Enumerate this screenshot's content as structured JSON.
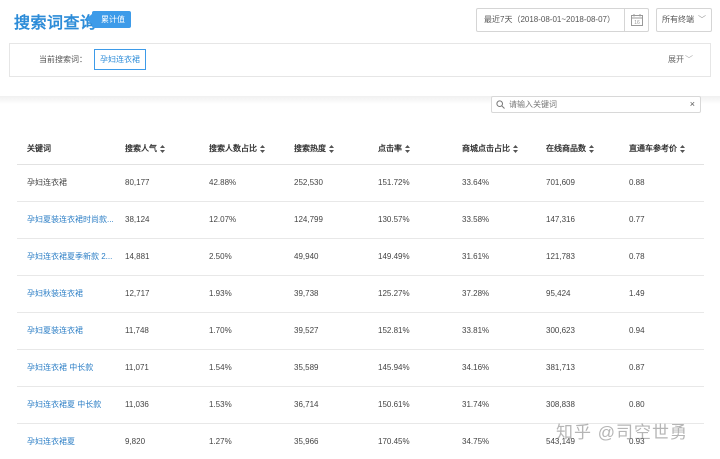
{
  "header": {
    "title": "搜索词查询",
    "badge": "累计值",
    "date_range": "最近7天（2018-08-01~2018-08-07）",
    "calendar_label": "16",
    "terminal": "所有终端"
  },
  "filter": {
    "label": "当前搜索词：",
    "keyword": "孕妇连衣裙",
    "expand": "展开"
  },
  "search": {
    "placeholder": "请输入关键词",
    "clear": "×"
  },
  "table": {
    "columns": [
      "关键词",
      "搜索人气",
      "搜索人数占比",
      "搜索热度",
      "点击率",
      "商城点击占比",
      "在线商品数",
      "直通车参考价"
    ],
    "rows": [
      [
        "孕妇连衣裙",
        "80,177",
        "42.88%",
        "252,530",
        "151.72%",
        "33.64%",
        "701,609",
        "0.88"
      ],
      [
        "孕妇夏装连衣裙时尚款...",
        "38,124",
        "12.07%",
        "124,799",
        "130.57%",
        "33.58%",
        "147,316",
        "0.77"
      ],
      [
        "孕妇连衣裙夏季新款 2...",
        "14,881",
        "2.50%",
        "49,940",
        "149.49%",
        "31.61%",
        "121,783",
        "0.78"
      ],
      [
        "孕妇秋装连衣裙",
        "12,717",
        "1.93%",
        "39,738",
        "125.27%",
        "37.28%",
        "95,424",
        "1.49"
      ],
      [
        "孕妇夏装连衣裙",
        "11,748",
        "1.70%",
        "39,527",
        "152.81%",
        "33.81%",
        "300,623",
        "0.94"
      ],
      [
        "孕妇连衣裙 中长款",
        "11,071",
        "1.54%",
        "35,589",
        "145.94%",
        "34.16%",
        "381,713",
        "0.87"
      ],
      [
        "孕妇连衣裙夏 中长款",
        "11,036",
        "1.53%",
        "36,714",
        "150.61%",
        "31.74%",
        "308,838",
        "0.80"
      ],
      [
        "孕妇连衣裙夏",
        "9,820",
        "1.27%",
        "35,966",
        "170.45%",
        "34.75%",
        "543,149",
        "0.93"
      ]
    ]
  },
  "watermark": "知乎 @司空世勇",
  "colors": {
    "accent": "#2d8cd8",
    "badge_bg": "#3d9be9",
    "link": "#2d7fc6"
  }
}
